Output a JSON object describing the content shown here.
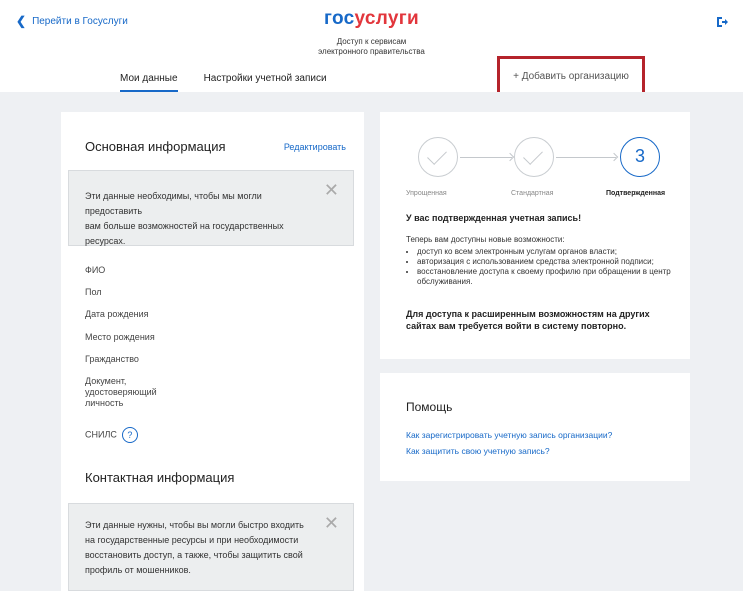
{
  "header": {
    "back_label": "Перейти в Госуслуги",
    "brand_part1": "гос",
    "brand_part2": "услуги",
    "subtitle_line1": "Доступ к сервисам",
    "subtitle_line2": "электронного правительства",
    "exit_icon": "logout-icon"
  },
  "tabs": [
    {
      "label": "Мои данные",
      "active": true
    },
    {
      "label": "Настройки учетной записи",
      "active": false
    }
  ],
  "add_org_label": "+ Добавить организацию",
  "basic": {
    "title": "Основная информация",
    "edit_label": "Редактировать",
    "notice_line1": "Эти данные необходимы, чтобы мы могли предоставить",
    "notice_line2": "вам больше возможностей на государственных",
    "notice_line3": "ресурсах.",
    "fields": [
      "ФИО",
      "Пол",
      "Дата рождения",
      "Место рождения",
      "Гражданство"
    ],
    "doc_line1": "Документ,",
    "doc_line2": "удостоверяющий",
    "doc_line3": "личность",
    "snils": "СНИЛС",
    "snils_help": "?"
  },
  "contact": {
    "title": "Контактная информация",
    "notice_line1": "Эти данные нужны, чтобы вы могли быстро входить",
    "notice_line2": "на государственные ресурсы и при необходимости",
    "notice_line3": "восстановить доступ, а также, чтобы защитить свой",
    "notice_line4": "профиль от мошенников."
  },
  "status": {
    "steps": [
      "Упрощенная",
      "Стандартная",
      "Подтвержденная"
    ],
    "current_number": "3",
    "title": "У вас подтвержденная учетная запись!",
    "intro": "Теперь вам доступны новые возможности:",
    "features": [
      "доступ ко всем электронным услугам органов власти;",
      "авторизация с использованием средства электронной подписи;",
      "восстановление доступа к своему профилю при обращении в центр обслуживания."
    ],
    "note_line1": "Для доступа к расширенным возможностям на других",
    "note_line2": "сайтах вам требуется войти в систему повторно."
  },
  "help": {
    "title": "Помощь",
    "link1": "Как зарегистрировать учетную запись организации?",
    "link2": "Как защитить свою учетную запись?"
  },
  "colors": {
    "accent": "#1769c8",
    "brand_red": "#e2363c",
    "highlight": "#b5232b"
  }
}
